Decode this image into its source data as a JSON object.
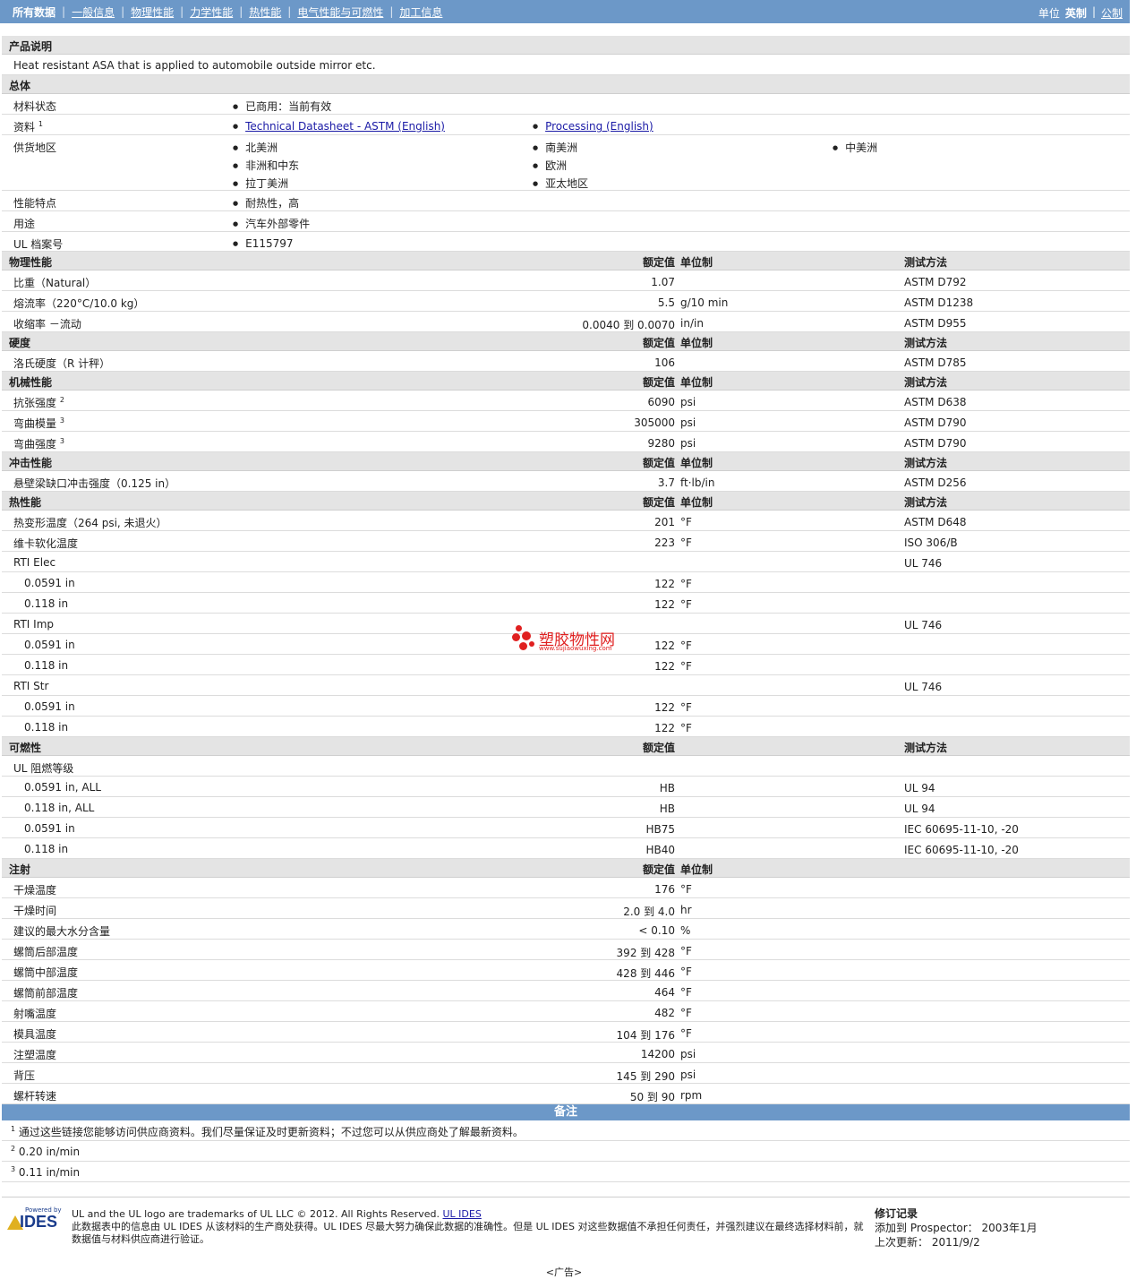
{
  "nav": {
    "items": [
      "所有数据",
      "一般信息",
      "物理性能",
      "力学性能",
      "热性能",
      "电气性能与可燃性",
      "加工信息"
    ],
    "unit_label": "单位",
    "unit_selected": "英制",
    "unit_other": "公制"
  },
  "description": {
    "title": "产品说明",
    "text": "Heat resistant ASA that is applied to automobile outside mirror etc."
  },
  "general": {
    "title": "总体",
    "status_label": "材料状态",
    "status_value": "已商用：当前有效",
    "docs_label": "资料",
    "docs_sup": "1",
    "doc1": "Technical Datasheet - ASTM (English)",
    "doc2": "Processing (English)",
    "regions_label": "供货地区",
    "regions": [
      "北美洲",
      "南美洲",
      "中美洲",
      "非洲和中东",
      "欧洲",
      "拉丁美洲",
      "亚太地区"
    ],
    "features_label": "性能特点",
    "features_value": "耐热性，高",
    "uses_label": "用途",
    "uses_value": "汽车外部零件",
    "ul_label": "UL 档案号",
    "ul_value": "E115797"
  },
  "headers": {
    "nominal": "额定值",
    "unit": "单位制",
    "method": "测试方法"
  },
  "sections": [
    {
      "title": "物理性能",
      "unit_col": true,
      "method_col": true,
      "rows": [
        {
          "label": "比重（Natural）",
          "value": "1.07",
          "unit": "",
          "method": "ASTM D792"
        },
        {
          "label": "熔流率（220°C/10.0 kg）",
          "value": "5.5",
          "unit": "g/10 min",
          "method": "ASTM D1238"
        },
        {
          "label": "收缩率 －流动",
          "value": "0.0040 到  0.0070",
          "unit": "in/in",
          "method": "ASTM D955"
        }
      ]
    },
    {
      "title": "硬度",
      "unit_col": true,
      "method_col": true,
      "rows": [
        {
          "label": "洛氏硬度（R 计秤）",
          "value": "106",
          "unit": "",
          "method": "ASTM D785"
        }
      ]
    },
    {
      "title": "机械性能",
      "unit_col": true,
      "method_col": true,
      "rows": [
        {
          "label": "抗张强度",
          "sup": "2",
          "value": "6090",
          "unit": "psi",
          "method": "ASTM D638"
        },
        {
          "label": "弯曲模量",
          "sup": "3",
          "value": "305000",
          "unit": "psi",
          "method": "ASTM D790"
        },
        {
          "label": "弯曲强度",
          "sup": "3",
          "value": "9280",
          "unit": "psi",
          "method": "ASTM D790"
        }
      ]
    },
    {
      "title": "冲击性能",
      "unit_col": true,
      "method_col": true,
      "rows": [
        {
          "label": "悬壁梁缺口冲击强度（0.125 in）",
          "value": "3.7",
          "unit": "ft·lb/in",
          "method": "ASTM D256"
        }
      ]
    },
    {
      "title": "热性能",
      "unit_col": true,
      "method_col": true,
      "rows": [
        {
          "label": "热变形温度（264 psi, 未退火）",
          "value": "201",
          "unit": "°F",
          "method": "ASTM D648"
        },
        {
          "label": "维卡软化温度",
          "value": "223",
          "unit": "°F",
          "method": "ISO 306/B"
        },
        {
          "label": "RTI Elec",
          "value": "",
          "unit": "",
          "method": "UL 746"
        },
        {
          "label": "0.0591 in",
          "sub": true,
          "value": "122",
          "unit": "°F",
          "method": ""
        },
        {
          "label": "0.118 in",
          "sub": true,
          "value": "122",
          "unit": "°F",
          "method": ""
        },
        {
          "label": "RTI Imp",
          "value": "",
          "unit": "",
          "method": "UL 746"
        },
        {
          "label": "0.0591 in",
          "sub": true,
          "value": "122",
          "unit": "°F",
          "method": ""
        },
        {
          "label": "0.118 in",
          "sub": true,
          "value": "122",
          "unit": "°F",
          "method": ""
        },
        {
          "label": "RTI Str",
          "value": "",
          "unit": "",
          "method": "UL 746"
        },
        {
          "label": "0.0591 in",
          "sub": true,
          "value": "122",
          "unit": "°F",
          "method": ""
        },
        {
          "label": "0.118 in",
          "sub": true,
          "value": "122",
          "unit": "°F",
          "method": ""
        }
      ]
    },
    {
      "title": "可燃性",
      "unit_col": false,
      "method_col": true,
      "rows": [
        {
          "label": "UL 阻燃等级",
          "value": "",
          "unit": "",
          "method": ""
        },
        {
          "label": "0.0591 in, ALL",
          "sub": true,
          "value": "HB",
          "unit": "",
          "method": "UL 94"
        },
        {
          "label": "0.118 in, ALL",
          "sub": true,
          "value": "HB",
          "unit": "",
          "method": "UL 94"
        },
        {
          "label": "0.0591 in",
          "sub": true,
          "value": "HB75",
          "unit": "",
          "method": "IEC 60695-11-10, -20"
        },
        {
          "label": "0.118 in",
          "sub": true,
          "value": "HB40",
          "unit": "",
          "method": "IEC 60695-11-10, -20"
        }
      ]
    },
    {
      "title": "注射",
      "unit_col": true,
      "method_col": false,
      "rows": [
        {
          "label": "干燥温度",
          "value": "176",
          "unit": "°F",
          "method": ""
        },
        {
          "label": "干燥时间",
          "value": "2.0 到  4.0",
          "unit": "hr",
          "method": ""
        },
        {
          "label": "建议的最大水分含量",
          "value": "< 0.10",
          "unit": "%",
          "method": ""
        },
        {
          "label": "螺筒后部温度",
          "value": "392 到  428",
          "unit": "°F",
          "method": ""
        },
        {
          "label": "螺筒中部温度",
          "value": "428 到  446",
          "unit": "°F",
          "method": ""
        },
        {
          "label": "螺筒前部温度",
          "value": "464",
          "unit": "°F",
          "method": ""
        },
        {
          "label": "射嘴温度",
          "value": "482",
          "unit": "°F",
          "method": ""
        },
        {
          "label": "模具温度",
          "value": "104 到  176",
          "unit": "°F",
          "method": ""
        },
        {
          "label": "注塑温度",
          "value": "14200",
          "unit": "psi",
          "method": ""
        },
        {
          "label": "背压",
          "value": "145 到  290",
          "unit": "psi",
          "method": ""
        },
        {
          "label": "螺杆转速",
          "value": "50 到  90",
          "unit": "rpm",
          "method": ""
        }
      ]
    }
  ],
  "notes": {
    "title": "备注",
    "items": [
      {
        "n": "1",
        "text": "通过这些链接您能够访问供应商资料。我们尽量保证及时更新资料；不过您可以从供应商处了解最新资料。"
      },
      {
        "n": "2",
        "text": "0.20 in/min"
      },
      {
        "n": "3",
        "text": "0.11 in/min"
      }
    ]
  },
  "footer": {
    "logo_powered": "Powered by",
    "logo_name": "IDES",
    "line1": "UL and the UL logo are trademarks of UL LLC © 2012. All Rights Reserved.",
    "line1_link": "UL IDES",
    "line2": "此数据表中的信息由  UL IDES 从该材料的生产商处获得。UL IDES 尽最大努力确保此数据的准确性。但是  UL IDES 对这些数据值不承担任何责任，并强烈建议在最终选择材料前，就数据值与材料供应商进行验证。",
    "rev_title": "修订记录",
    "rev_added": "添加到  Prospector： 2003年1月",
    "rev_updated": "上次更新：  2011/9/2",
    "ad": "<广告>"
  },
  "watermark": {
    "cn": "塑胶物性网",
    "url": "www.sujiaowuxing.com"
  }
}
